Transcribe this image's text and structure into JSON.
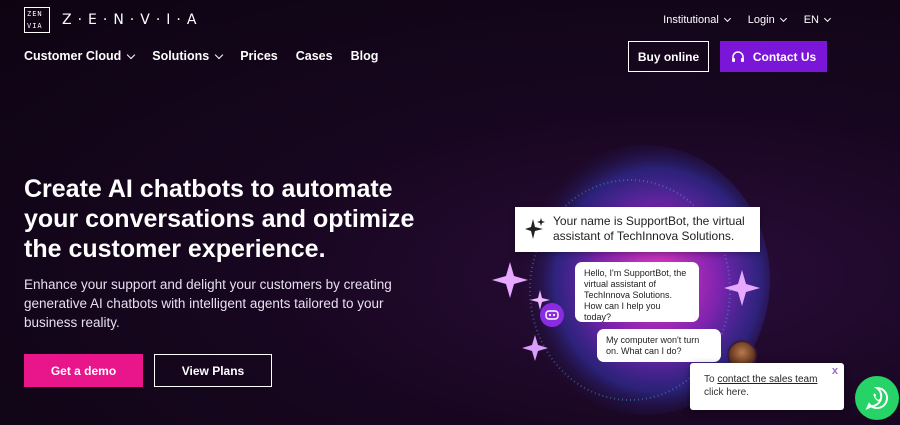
{
  "brand": {
    "name": "Z·E·N·V·I·A",
    "mark_lines": [
      "ZEN",
      "VIA"
    ]
  },
  "top_links": [
    {
      "label": "Institutional"
    },
    {
      "label": "Login"
    },
    {
      "label": "EN"
    }
  ],
  "nav": {
    "items": [
      {
        "label": "Customer Cloud",
        "dropdown": true
      },
      {
        "label": "Solutions",
        "dropdown": true
      },
      {
        "label": "Prices",
        "dropdown": false
      },
      {
        "label": "Cases",
        "dropdown": false
      },
      {
        "label": "Blog",
        "dropdown": false
      }
    ]
  },
  "header_buttons": {
    "buy": "Buy online",
    "contact": "Contact Us"
  },
  "hero": {
    "title": "Create AI chatbots to automate your conversations and optimize the customer experience.",
    "subtitle": "Enhance your support and delight your customers by creating generative AI chatbots with intelligent agents tailored to your business reality.",
    "demo_button": "Get a demo",
    "plans_button": "View Plans"
  },
  "illustration": {
    "card_text": "Your name is SupportBot, the virtual assistant of TechInnova Solutions.",
    "bot_message": "Hello, I'm SupportBot, the virtual assistant of TechInnova Solutions. How can I help you today?",
    "user_message": "My computer won't turn on. What can I do?"
  },
  "popup": {
    "prefix": "To ",
    "link_text": "contact the sales team",
    "suffix": "click here.",
    "close": "x"
  },
  "colors": {
    "accent_purple": "#7b16d9",
    "accent_pink": "#e8168a",
    "whatsapp_green": "#25d366",
    "background": "#17061f"
  },
  "icons": [
    "logo-mark-icon",
    "chevron-down-icon",
    "headset-icon",
    "sparkle-icon",
    "bot-icon",
    "whatsapp-icon"
  ]
}
